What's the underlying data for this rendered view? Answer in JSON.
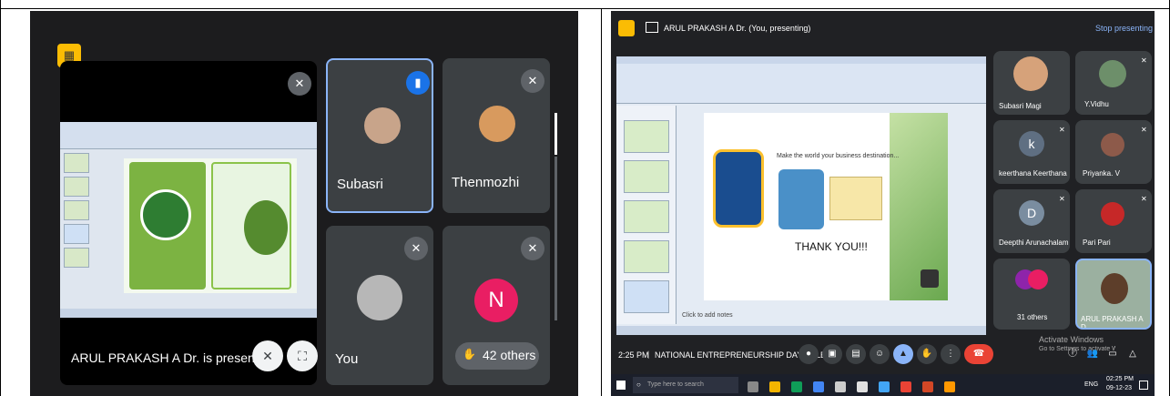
{
  "left": {
    "presenter_label": "ARUL PRAKASH A Dr. is presenting",
    "participants": [
      {
        "name": "Subasri"
      },
      {
        "name": "Thenmozhi"
      },
      {
        "name": "You"
      },
      {
        "avatar_letter": "N",
        "others_label": "42 others"
      }
    ]
  },
  "right": {
    "presenting_banner": "ARUL PRAKASH A Dr. (You, presenting)",
    "stop_presenting": "Stop presenting",
    "slide": {
      "heading": "Make the world your business destination...",
      "thanks": "THANK YOU!!!",
      "notes": "Click to add notes"
    },
    "participants": [
      {
        "name": "Subasri Magi"
      },
      {
        "name": "Y.Vidhu"
      },
      {
        "avatar_letter": "k",
        "name": "keerthana Keerthana"
      },
      {
        "name": "Priyanka. V"
      },
      {
        "avatar_letter": "D",
        "name": "Deepthi Arunachalam"
      },
      {
        "name": "Pari Pari"
      },
      {
        "name": "31 others"
      },
      {
        "name": "ARUL PRAKASH A D"
      }
    ],
    "meeting": {
      "time": "2:25 PM",
      "title": "NATIONAL ENTREPRENEURSHIP DAY CELEB..."
    },
    "watermark": {
      "line1": "Activate Windows",
      "line2": "Go to Settings to activate Windows."
    },
    "taskbar": {
      "search_placeholder": "Type here to search",
      "clock_time": "02:25 PM",
      "clock_date": "09-12-23",
      "tray": "ENG"
    }
  },
  "colors": {
    "meet_bg": "#202124",
    "tile_bg": "#3c4043",
    "active_border": "#8ab4f8",
    "end_call": "#ea4335",
    "slide_green": "#6aa84f",
    "avatar_pink": "#e91e63"
  }
}
